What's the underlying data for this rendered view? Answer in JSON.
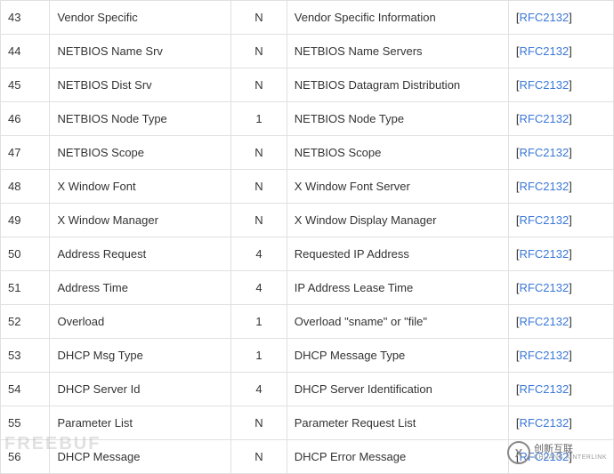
{
  "rows": [
    {
      "num": "43",
      "name": "Vendor Specific",
      "len": "N",
      "desc": "Vendor Specific Information",
      "ref": "RFC2132"
    },
    {
      "num": "44",
      "name": "NETBIOS Name Srv",
      "len": "N",
      "desc": "NETBIOS Name Servers",
      "ref": "RFC2132"
    },
    {
      "num": "45",
      "name": "NETBIOS Dist Srv",
      "len": "N",
      "desc": "NETBIOS Datagram Distribution",
      "ref": "RFC2132"
    },
    {
      "num": "46",
      "name": "NETBIOS Node Type",
      "len": "1",
      "desc": "NETBIOS Node Type",
      "ref": "RFC2132"
    },
    {
      "num": "47",
      "name": "NETBIOS Scope",
      "len": "N",
      "desc": "NETBIOS Scope",
      "ref": "RFC2132"
    },
    {
      "num": "48",
      "name": "X Window Font",
      "len": "N",
      "desc": "X Window Font Server",
      "ref": "RFC2132"
    },
    {
      "num": "49",
      "name": "X Window Manager",
      "len": "N",
      "desc": "X Window Display Manager",
      "ref": "RFC2132"
    },
    {
      "num": "50",
      "name": "Address Request",
      "len": "4",
      "desc": "Requested IP Address",
      "ref": "RFC2132"
    },
    {
      "num": "51",
      "name": "Address Time",
      "len": "4",
      "desc": "IP Address Lease Time",
      "ref": "RFC2132"
    },
    {
      "num": "52",
      "name": "Overload",
      "len": "1",
      "desc": "Overload \"sname\" or \"file\"",
      "ref": "RFC2132"
    },
    {
      "num": "53",
      "name": "DHCP Msg Type",
      "len": "1",
      "desc": "DHCP Message Type",
      "ref": "RFC2132"
    },
    {
      "num": "54",
      "name": "DHCP Server Id",
      "len": "4",
      "desc": "DHCP Server Identification",
      "ref": "RFC2132"
    },
    {
      "num": "55",
      "name": "Parameter List",
      "len": "N",
      "desc": "Parameter Request List",
      "ref": "RFC2132"
    },
    {
      "num": "56",
      "name": "DHCP Message",
      "len": "N",
      "desc": "DHCP Error Message",
      "ref": "RFC2132"
    }
  ],
  "watermark_left": "FREEBUF",
  "watermark_right": {
    "logo_letter": "X",
    "line1": "创新互联",
    "line2": "CHUANG XINTERLINK"
  }
}
